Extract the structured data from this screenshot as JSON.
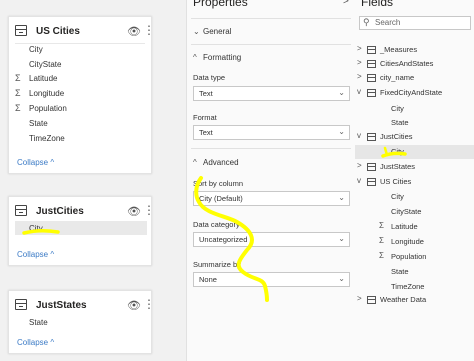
{
  "canvas": {
    "cards": [
      {
        "title": "US Cities",
        "fields": [
          {
            "label": "City",
            "icon": "none"
          },
          {
            "label": "CityState",
            "icon": "none"
          },
          {
            "label": "Latitude",
            "icon": "sigma-icon"
          },
          {
            "label": "Longitude",
            "icon": "sigma-icon"
          },
          {
            "label": "Population",
            "icon": "sigma-icon"
          },
          {
            "label": "State",
            "icon": "none"
          },
          {
            "label": "TimeZone",
            "icon": "none"
          }
        ],
        "collapse_label": "Collapse ^"
      },
      {
        "title": "JustCities",
        "fields": [
          {
            "label": "City",
            "icon": "none",
            "selected": true
          }
        ],
        "collapse_label": "Collapse ^"
      },
      {
        "title": "JustStates",
        "fields": [
          {
            "label": "State",
            "icon": "none"
          }
        ],
        "collapse_label": "Collapse ^"
      }
    ],
    "visibility_icon": "eye-icon",
    "more_icon": "more-options-icon"
  },
  "properties": {
    "title": "Properties",
    "sections": {
      "general": "General",
      "formatting": "Formatting",
      "advanced": "Advanced"
    },
    "data_type": {
      "label": "Data type",
      "value": "Text"
    },
    "format": {
      "label": "Format",
      "value": "Text"
    },
    "sort_by_column": {
      "label": "Sort by column",
      "value": "City (Default)"
    },
    "data_category": {
      "label": "Data category",
      "value": "Uncategorized"
    },
    "summarize_by": {
      "label": "Summarize by",
      "value": "None"
    },
    "expand_icon": ">"
  },
  "fields_panel": {
    "title": "Fields",
    "search_placeholder": "Search",
    "items": [
      {
        "label": "_Measures",
        "level": 0,
        "chevron": ">",
        "icon": "table-icon"
      },
      {
        "label": "CitiesAndStates",
        "level": 0,
        "chevron": ">",
        "icon": "table-icon"
      },
      {
        "label": "city_name",
        "level": 0,
        "chevron": ">",
        "icon": "table-icon"
      },
      {
        "label": "FixedCityAndState",
        "level": 0,
        "chevron": "v",
        "icon": "table-icon"
      },
      {
        "label": "City",
        "level": 1
      },
      {
        "label": "State",
        "level": 1
      },
      {
        "label": "JustCities",
        "level": 0,
        "chevron": "v",
        "icon": "table-icon"
      },
      {
        "label": "City",
        "level": 1,
        "selected": true
      },
      {
        "label": "JustStates",
        "level": 0,
        "chevron": ">",
        "icon": "table-icon"
      },
      {
        "label": "US Cities",
        "level": 0,
        "chevron": "v",
        "icon": "table-icon"
      },
      {
        "label": "City",
        "level": 1
      },
      {
        "label": "CityState",
        "level": 1
      },
      {
        "label": "Latitude",
        "level": 1,
        "sigma": true
      },
      {
        "label": "Longitude",
        "level": 1,
        "sigma": true
      },
      {
        "label": "Population",
        "level": 1,
        "sigma": true
      },
      {
        "label": "State",
        "level": 1
      },
      {
        "label": "TimeZone",
        "level": 1
      },
      {
        "label": "Weather Data",
        "level": 0,
        "chevron": ">",
        "icon": "table-icon"
      }
    ]
  },
  "annotation_color": "#ffff00"
}
